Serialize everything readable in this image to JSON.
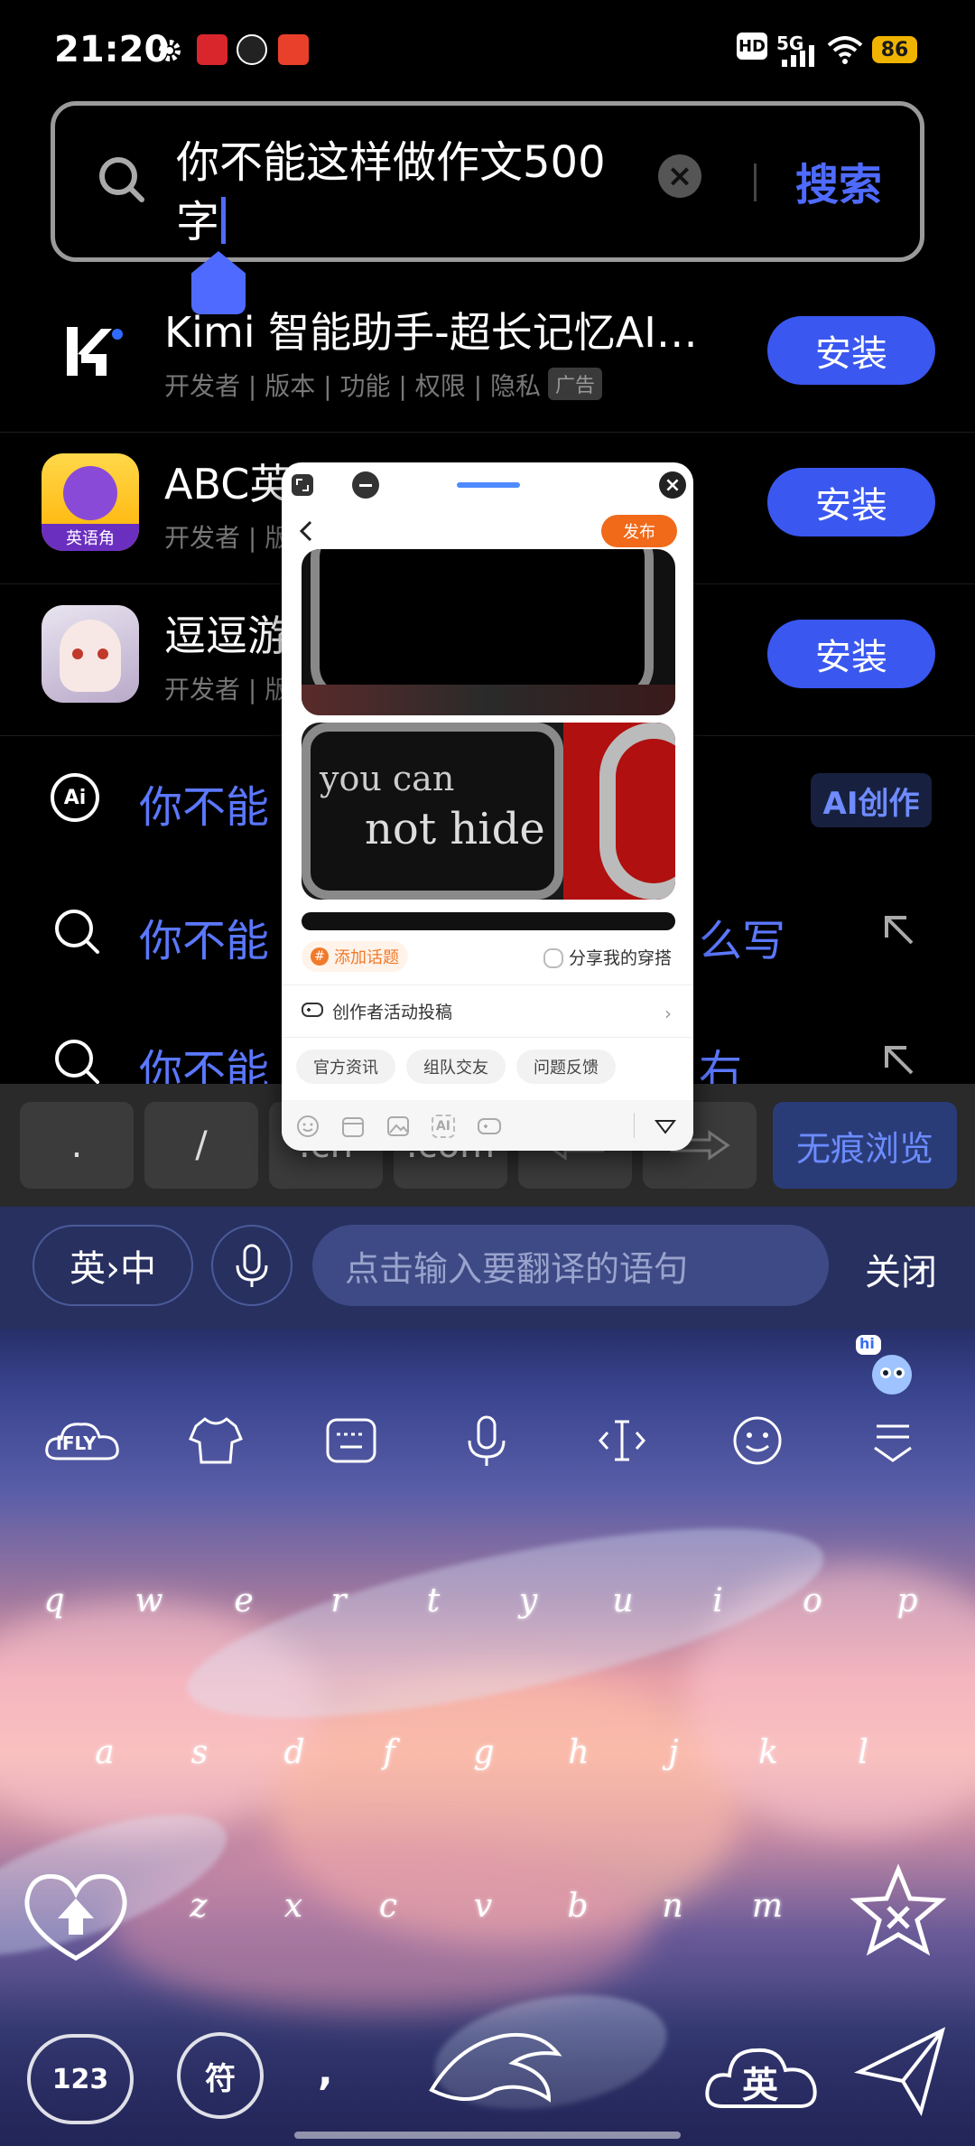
{
  "status_bar": {
    "time": "21:20",
    "network": "5G",
    "hd": "HD",
    "battery": "86"
  },
  "search": {
    "query_line1": "你不能这样做作文500",
    "query_line2": "字",
    "submit_label": "搜索"
  },
  "apps": [
    {
      "name": "Kimi 智能助手-超长记忆AI…",
      "meta": "开发者 | 版本 | 功能 | 权限 | 隐私",
      "ad": "广告",
      "install": "安装"
    },
    {
      "name": "ABC英",
      "meta": "开发者 | 版",
      "badge": "英语角",
      "install": "安装"
    },
    {
      "name": "逗逗游",
      "meta": "开发者 | 版",
      "install": "安装"
    }
  ],
  "suggestions": [
    {
      "text": "你不能",
      "tail": "",
      "chip": "AI创作"
    },
    {
      "text": "你不能",
      "tail": "么写"
    },
    {
      "text": "你不能",
      "tail": "右"
    }
  ],
  "quick_keys": [
    ".",
    "/",
    ".cn",
    ".com"
  ],
  "quick_right": "无痕浏览",
  "translate": {
    "lang_toggle": "英›中",
    "placeholder": "点击输入要翻译的语句",
    "close": "关闭"
  },
  "keyboard": {
    "brand": "iFLY",
    "hi": "hi",
    "row1": [
      "q",
      "w",
      "e",
      "r",
      "t",
      "y",
      "u",
      "i",
      "o",
      "p"
    ],
    "row2": [
      "a",
      "s",
      "d",
      "f",
      "g",
      "h",
      "j",
      "k",
      "l"
    ],
    "row3": [
      "z",
      "x",
      "c",
      "v",
      "b",
      "n",
      "m"
    ],
    "num_key": "123",
    "sym_key": "符",
    "comma": ",",
    "lang_key": "英"
  },
  "popup": {
    "publish": "发布",
    "image_text_1": "you can",
    "image_text_2": "not hide",
    "add_topic": "添加话题",
    "share_outfit": "分享我的穿搭",
    "creator_row": "创作者活动投稿",
    "chips": [
      "官方资讯",
      "组队交友",
      "问题反馈"
    ]
  },
  "colors": {
    "accent": "#3a57f0",
    "accent_text": "#5b78ff",
    "publish": "#f06a1a"
  }
}
